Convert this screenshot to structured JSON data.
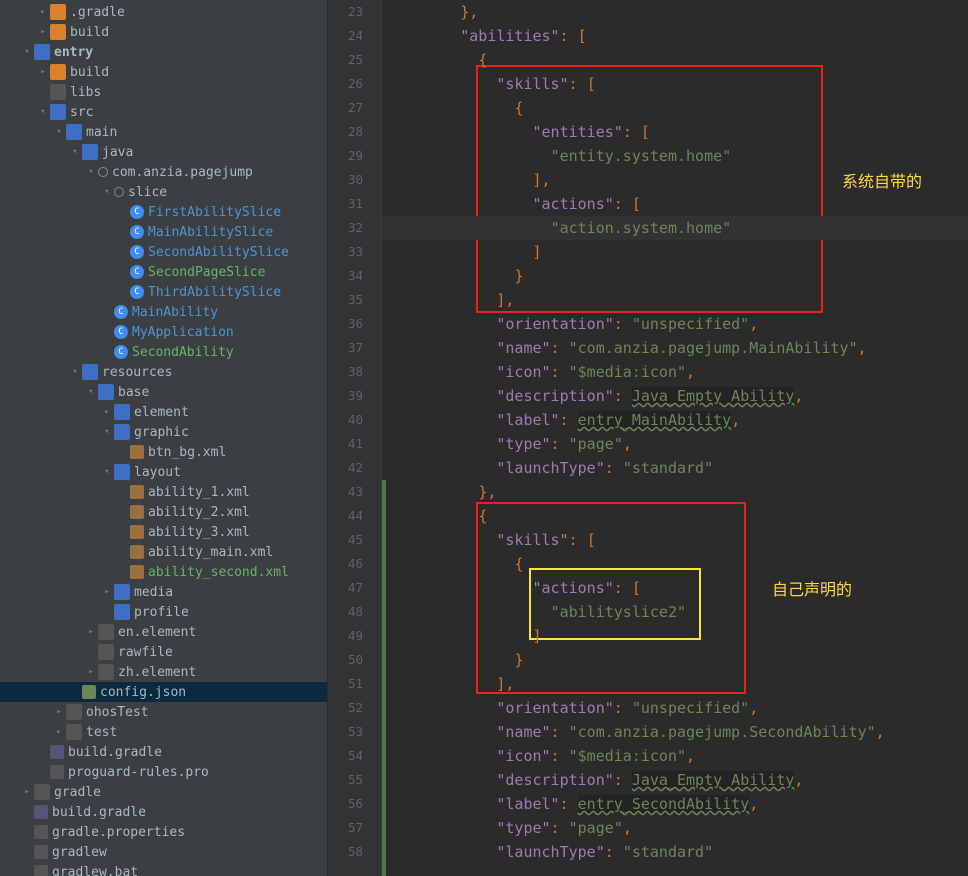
{
  "tree": [
    {
      "d": 2,
      "a": ">",
      "i": "folder-orange",
      "l": ".gradle"
    },
    {
      "d": 2,
      "a": ">",
      "i": "folder-orange",
      "l": "build"
    },
    {
      "d": 1,
      "a": "v",
      "i": "folder-blue",
      "l": "entry",
      "bold": true
    },
    {
      "d": 2,
      "a": ">",
      "i": "folder-orange",
      "l": "build"
    },
    {
      "d": 2,
      "a": "",
      "i": "folder-gray",
      "l": "libs"
    },
    {
      "d": 2,
      "a": "v",
      "i": "folder-blue",
      "l": "src"
    },
    {
      "d": 3,
      "a": "v",
      "i": "folder-blue",
      "l": "main"
    },
    {
      "d": 4,
      "a": "v",
      "i": "folder-blue",
      "l": "java"
    },
    {
      "d": 5,
      "a": "v",
      "i": "pkg",
      "l": "com.anzia.pagejump"
    },
    {
      "d": 6,
      "a": "v",
      "i": "pkg",
      "l": "slice"
    },
    {
      "d": 7,
      "a": "",
      "i": "class-c",
      "l": "FirstAbilitySlice",
      "c": "#4e93d6"
    },
    {
      "d": 7,
      "a": "",
      "i": "class-c",
      "l": "MainAbilitySlice",
      "c": "#4e93d6"
    },
    {
      "d": 7,
      "a": "",
      "i": "class-c",
      "l": "SecondAbilitySlice",
      "c": "#4e93d6"
    },
    {
      "d": 7,
      "a": "",
      "i": "class-c",
      "l": "SecondPageSlice",
      "c": "#69b36c"
    },
    {
      "d": 7,
      "a": "",
      "i": "class-c",
      "l": "ThirdAbilitySlice",
      "c": "#4e93d6"
    },
    {
      "d": 6,
      "a": "",
      "i": "class-c",
      "l": "MainAbility",
      "c": "#4e93d6"
    },
    {
      "d": 6,
      "a": "",
      "i": "class-c",
      "l": "MyApplication",
      "c": "#4e93d6"
    },
    {
      "d": 6,
      "a": "",
      "i": "class-c",
      "l": "SecondAbility",
      "c": "#69b36c"
    },
    {
      "d": 4,
      "a": "v",
      "i": "folder-blue",
      "l": "resources"
    },
    {
      "d": 5,
      "a": "v",
      "i": "folder-blue",
      "l": "base"
    },
    {
      "d": 6,
      "a": ">",
      "i": "folder-blue",
      "l": "element"
    },
    {
      "d": 6,
      "a": "v",
      "i": "folder-blue",
      "l": "graphic"
    },
    {
      "d": 7,
      "a": "",
      "i": "file-xml",
      "l": "btn_bg.xml"
    },
    {
      "d": 6,
      "a": "v",
      "i": "folder-blue",
      "l": "layout"
    },
    {
      "d": 7,
      "a": "",
      "i": "file-xml",
      "l": "ability_1.xml"
    },
    {
      "d": 7,
      "a": "",
      "i": "file-xml",
      "l": "ability_2.xml"
    },
    {
      "d": 7,
      "a": "",
      "i": "file-xml",
      "l": "ability_3.xml"
    },
    {
      "d": 7,
      "a": "",
      "i": "file-xml",
      "l": "ability_main.xml"
    },
    {
      "d": 7,
      "a": "",
      "i": "file-xml",
      "l": "ability_second.xml",
      "c": "#69b36c"
    },
    {
      "d": 6,
      "a": ">",
      "i": "folder-blue",
      "l": "media"
    },
    {
      "d": 6,
      "a": "",
      "i": "folder-blue",
      "l": "profile"
    },
    {
      "d": 5,
      "a": ">",
      "i": "folder-gray",
      "l": "en.element"
    },
    {
      "d": 5,
      "a": "",
      "i": "folder-gray",
      "l": "rawfile"
    },
    {
      "d": 5,
      "a": ">",
      "i": "folder-gray",
      "l": "zh.element"
    },
    {
      "d": 4,
      "a": "",
      "i": "file-json",
      "l": "config.json",
      "sel": true
    },
    {
      "d": 3,
      "a": ">",
      "i": "folder-gray",
      "l": "ohosTest"
    },
    {
      "d": 3,
      "a": ">",
      "i": "folder-gray",
      "l": "test"
    },
    {
      "d": 2,
      "a": "",
      "i": "file-gradle",
      "l": "build.gradle"
    },
    {
      "d": 2,
      "a": "",
      "i": "file-txt",
      "l": "proguard-rules.pro"
    },
    {
      "d": 1,
      "a": ">",
      "i": "folder-gray",
      "l": "gradle"
    },
    {
      "d": 1,
      "a": "",
      "i": "file-gradle",
      "l": "build.gradle"
    },
    {
      "d": 1,
      "a": "",
      "i": "file-txt",
      "l": "gradle.properties"
    },
    {
      "d": 1,
      "a": "",
      "i": "file-txt",
      "l": "gradlew"
    },
    {
      "d": 1,
      "a": "",
      "i": "file-txt",
      "l": "gradlew.bat"
    }
  ],
  "annotations": {
    "system": "系统自带的",
    "self": "自己声明的"
  },
  "code_lines": [
    {
      "n": 23,
      "t": "        },"
    },
    {
      "n": 24,
      "t": "        \"abilities\": ["
    },
    {
      "n": 25,
      "t": "          {"
    },
    {
      "n": 26,
      "t": "            \"skills\": ["
    },
    {
      "n": 27,
      "t": "              {"
    },
    {
      "n": 28,
      "t": "                \"entities\": ["
    },
    {
      "n": 29,
      "t": "                  \"entity.system.home\""
    },
    {
      "n": 30,
      "t": "                ],"
    },
    {
      "n": 31,
      "t": "                \"actions\": ["
    },
    {
      "n": 32,
      "t": "                  \"action.system.home\"",
      "hl": true
    },
    {
      "n": 33,
      "t": "                ]"
    },
    {
      "n": 34,
      "t": "              }"
    },
    {
      "n": 35,
      "t": "            ],"
    },
    {
      "n": 36,
      "t": "            \"orientation\": \"unspecified\","
    },
    {
      "n": 37,
      "t": "            \"name\": \"com.anzia.pagejump.MainAbility\","
    },
    {
      "n": 38,
      "t": "            \"icon\": \"$media:icon\","
    },
    {
      "n": 39,
      "t": "            \"description\": Java_Empty Ability,"
    },
    {
      "n": 40,
      "t": "            \"label\": entry_MainAbility,"
    },
    {
      "n": 41,
      "t": "            \"type\": \"page\","
    },
    {
      "n": 42,
      "t": "            \"launchType\": \"standard\""
    },
    {
      "n": 43,
      "t": "          },"
    },
    {
      "n": 44,
      "t": "          {"
    },
    {
      "n": 45,
      "t": "            \"skills\": ["
    },
    {
      "n": 46,
      "t": "              {"
    },
    {
      "n": 47,
      "t": "                \"actions\": ["
    },
    {
      "n": 48,
      "t": "                  \"abilityslice2\""
    },
    {
      "n": 49,
      "t": "                ]"
    },
    {
      "n": 50,
      "t": "              }"
    },
    {
      "n": 51,
      "t": "            ],"
    },
    {
      "n": 52,
      "t": "            \"orientation\": \"unspecified\","
    },
    {
      "n": 53,
      "t": "            \"name\": \"com.anzia.pagejump.SecondAbility\","
    },
    {
      "n": 54,
      "t": "            \"icon\": \"$media:icon\","
    },
    {
      "n": 55,
      "t": "            \"description\": Java_Empty Ability,"
    },
    {
      "n": 56,
      "t": "            \"label\": entry_SecondAbility,"
    },
    {
      "n": 57,
      "t": "            \"type\": \"page\","
    },
    {
      "n": 58,
      "t": "            \"launchType\": \"standard\""
    }
  ]
}
